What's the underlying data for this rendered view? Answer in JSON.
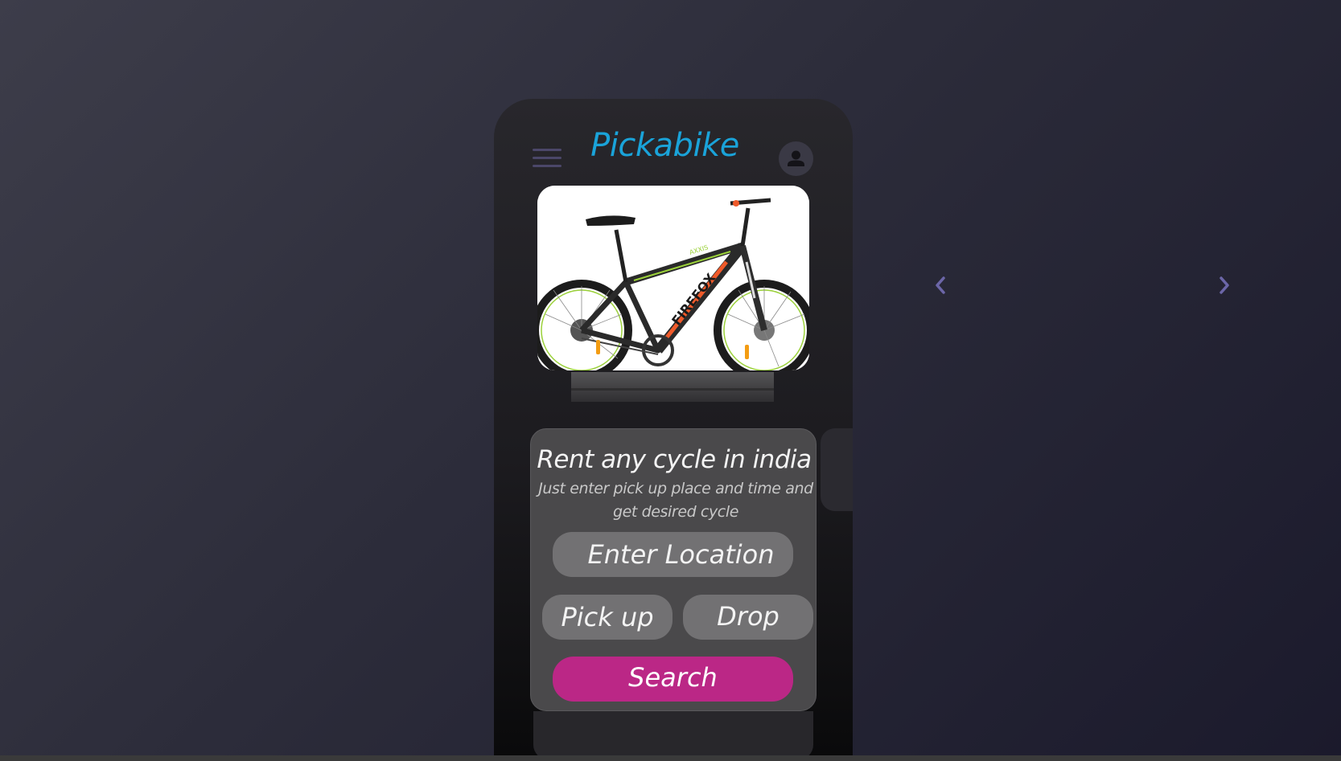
{
  "app": {
    "title": "Pickabike"
  },
  "icons": {
    "menu": "hamburger-menu-icon",
    "profile": "user-avatar-icon",
    "prev": "chevron-left-icon",
    "next": "chevron-right-icon"
  },
  "hero": {
    "image": "mountain-bike-photo",
    "bike_text": "FIREFOX",
    "model_text": "AXXIS"
  },
  "form": {
    "title": "Rent any cycle in india",
    "subtitle_line1": "Just enter pick up place and time and",
    "subtitle_line2": "get desired cycle",
    "location_placeholder": "Enter Location",
    "pickup_label": "Pick up",
    "drop_label": "Drop",
    "search_label": "Search"
  },
  "colors": {
    "brand": "#1aa3d9",
    "search_button": "#bb2786",
    "pill": "#727173",
    "card": "#4a494b",
    "arrow": "#6c66a8"
  }
}
